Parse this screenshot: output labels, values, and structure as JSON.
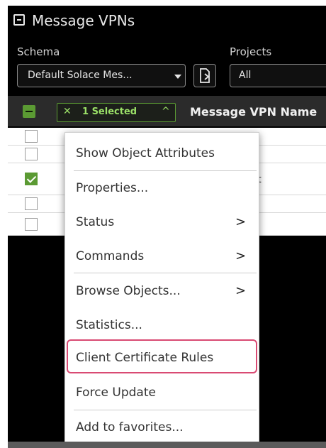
{
  "window": {
    "title": "Message VPNs"
  },
  "filters": {
    "schema_label": "Schema",
    "schema_value": "Default Solace Mes...",
    "projects_label": "Projects",
    "projects_value": "All"
  },
  "table": {
    "selection_label": "1 Selected",
    "column_header": "Message VPN Name",
    "rows": [
      {
        "checked": false,
        "text": ""
      },
      {
        "checked": false,
        "text": ""
      },
      {
        "checked": true,
        "text": "st"
      },
      {
        "checked": false,
        "text": ""
      },
      {
        "checked": false,
        "text": ""
      }
    ]
  },
  "context_menu": {
    "items": [
      {
        "label": "Show Object Attributes",
        "submenu": false
      },
      {
        "label": "Properties...",
        "submenu": false
      },
      {
        "label": "Status",
        "submenu": true
      },
      {
        "label": "Commands",
        "submenu": true
      },
      {
        "label": "Browse Objects...",
        "submenu": true
      },
      {
        "label": "Statistics...",
        "submenu": false
      },
      {
        "label": "Client Certificate Rules",
        "submenu": false,
        "highlighted": true
      },
      {
        "label": "Force Update",
        "submenu": false
      },
      {
        "label": "Add to favorites...",
        "submenu": false
      }
    ]
  },
  "colors": {
    "accent": "#5b9a33",
    "highlight_border": "#d94a73",
    "panel_bg": "#000000"
  }
}
